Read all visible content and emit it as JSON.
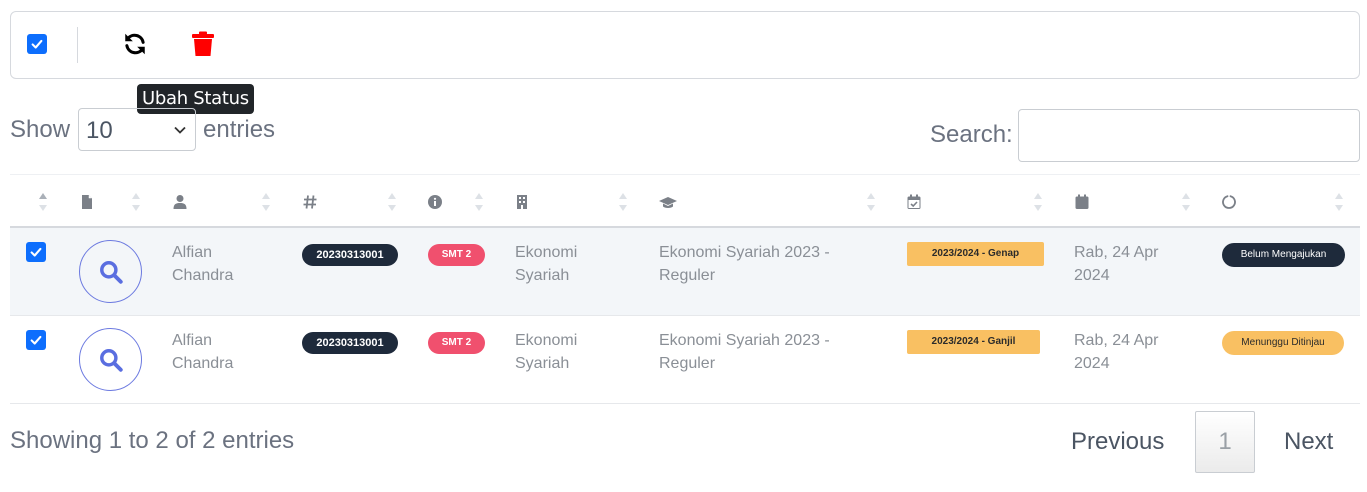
{
  "toolbar": {
    "select_all_checked": true,
    "refresh_icon": "refresh-icon",
    "delete_icon": "trash-icon",
    "tooltip": "Ubah Status"
  },
  "length": {
    "show_label": "Show",
    "value": "10",
    "entries_label": "entries"
  },
  "search": {
    "label": "Search:",
    "value": ""
  },
  "columns": [
    {
      "icon": "checkbox-column"
    },
    {
      "icon": "file-icon"
    },
    {
      "icon": "user-icon"
    },
    {
      "icon": "hash-icon"
    },
    {
      "icon": "info-icon"
    },
    {
      "icon": "building-icon"
    },
    {
      "icon": "graduation-cap-icon"
    },
    {
      "icon": "calendar-check-icon"
    },
    {
      "icon": "calendar-icon"
    },
    {
      "icon": "circle-notch-icon"
    }
  ],
  "rows": [
    {
      "checked": true,
      "name_1": "Alfian",
      "name_2": "Chandra",
      "nim": "20230313001",
      "semester": "SMT 2",
      "prodi_1": "Ekonomi",
      "prodi_2": "Syariah",
      "kelas_1": "Ekonomi Syariah 2023 -",
      "kelas_2": "Reguler",
      "periode": "2023/2024 - Genap",
      "date_1": "Rab, 24 Apr",
      "date_2": "2024",
      "status": "Belum Mengajukan",
      "status_color": "#1e2a3b"
    },
    {
      "checked": true,
      "name_1": "Alfian",
      "name_2": "Chandra",
      "nim": "20230313001",
      "semester": "SMT 2",
      "prodi_1": "Ekonomi",
      "prodi_2": "Syariah",
      "kelas_1": "Ekonomi Syariah 2023 -",
      "kelas_2": "Reguler",
      "periode": "2023/2024 - Ganjil",
      "date_1": "Rab, 24 Apr",
      "date_2": "2024",
      "status": "Menunggu Ditinjau",
      "status_color": "#f9c062"
    }
  ],
  "footer": {
    "info": "Showing 1 to 2 of 2 entries",
    "previous": "Previous",
    "page": "1",
    "next": "Next"
  },
  "colors": {
    "accent": "#0d6efd",
    "danger": "#ff0000",
    "dark_badge": "#1e2a3b",
    "semester_badge": "#f0506e",
    "period_badge": "#f9c062"
  }
}
